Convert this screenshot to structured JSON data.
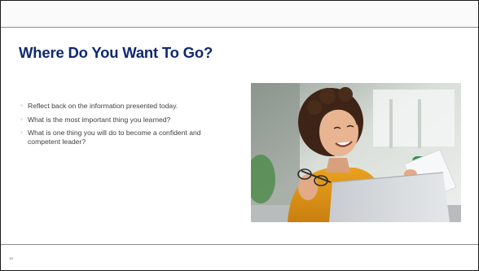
{
  "slide": {
    "title": "Where Do You Want To Go?",
    "bullets": [
      {
        "text": "Reflect back on the information presented today."
      },
      {
        "text": "What is the most important thing you learned?"
      },
      {
        "text": "What is one thing you will do to become a confident and competent leader?"
      }
    ],
    "bullet_marker": "◦",
    "image": {
      "description_icon": "photo-smiling-woman-laptop-icon"
    },
    "slide_number": "16"
  },
  "colors": {
    "title": "#0f2a6e",
    "body_text": "#404040",
    "bullet_marker": "#6f90c8",
    "rule": "#8c8c8c"
  }
}
